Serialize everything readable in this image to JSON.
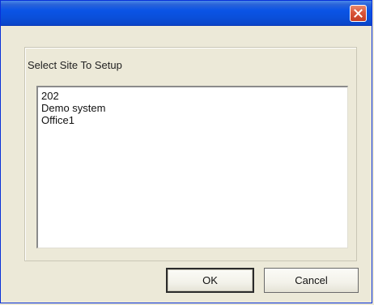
{
  "dialog": {
    "group_label": "Select Site To Setup",
    "sites": [
      "202",
      "Demo system",
      "Office1"
    ],
    "ok_label": "OK",
    "cancel_label": "Cancel"
  },
  "icons": {
    "close": "close-icon"
  },
  "colors": {
    "titlebar": "#0a54e6",
    "close_button": "#d9553a",
    "dialog_background": "#ece9d8"
  }
}
